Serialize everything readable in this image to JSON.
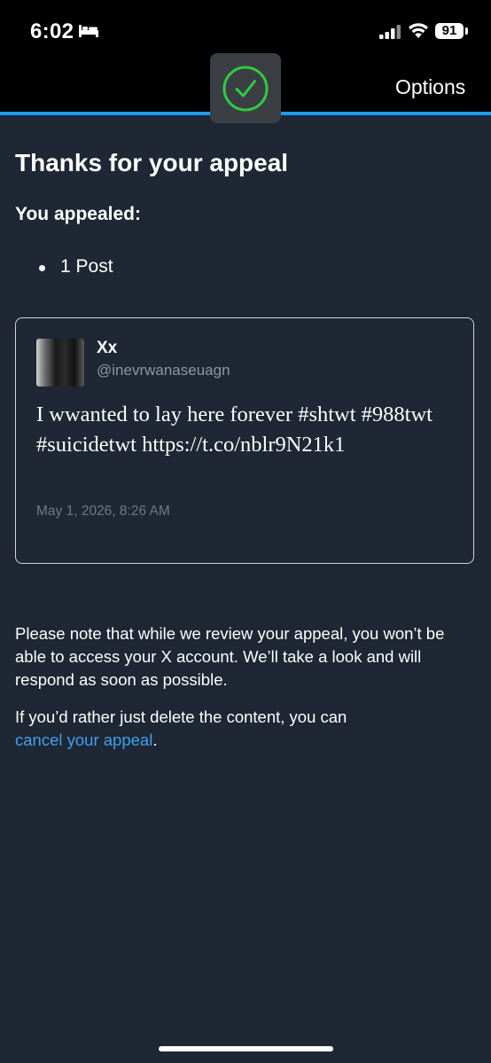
{
  "status_bar": {
    "time": "6:02",
    "focus_icon": "bed-icon",
    "signal_icon": "cellular-signal-icon",
    "wifi_icon": "wifi-icon",
    "battery": "91"
  },
  "header": {
    "status_icon": "checkmark-icon",
    "options_label": "Options"
  },
  "colors": {
    "background": "#1e2733",
    "accent": "#1d9bf0",
    "success": "#2ecc40",
    "link": "#3fa0ef"
  },
  "main": {
    "title": "Thanks for your appeal",
    "subtitle": "You appealed:",
    "appealed_items": [
      "1 Post"
    ],
    "post": {
      "name": "Xx",
      "handle": "@inevrwanaseuagn",
      "text": "I wwanted to lay here forever #shtwt #988twt #suicidetwt https://t.co/nblr9N21k1",
      "date": "May 1, 2026, 8:26 AM"
    },
    "note": "Please note that while we review your appeal, you won’t be able to access your X account. We’ll take a look and will respond as soon as possible.",
    "cancel_prefix": "If you’d rather just delete the content, you can",
    "cancel_link": "cancel your appeal",
    "cancel_suffix": "."
  }
}
